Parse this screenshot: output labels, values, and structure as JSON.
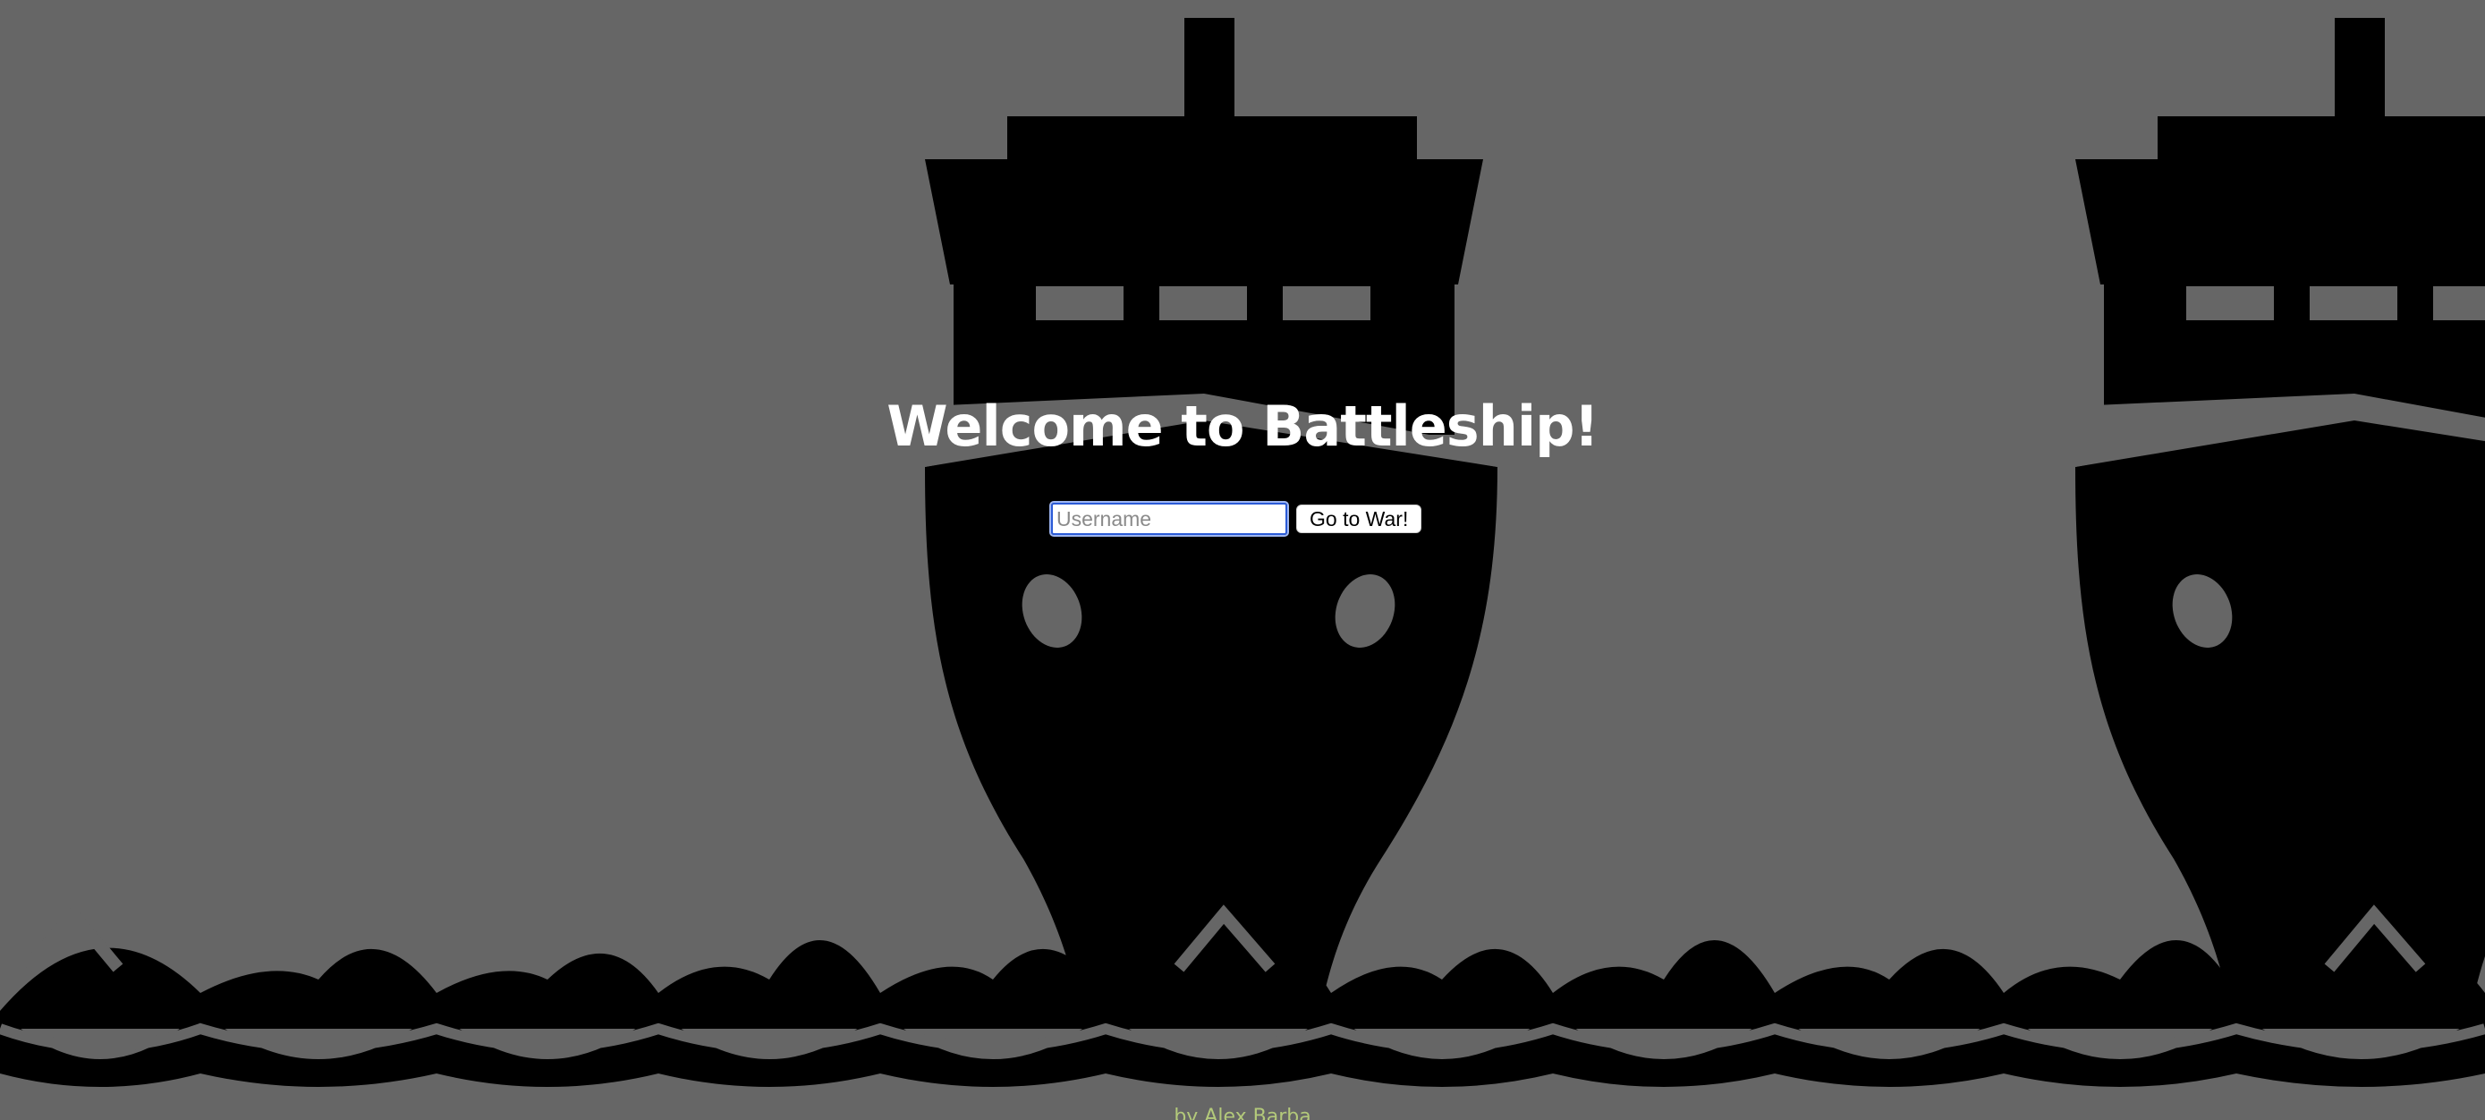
{
  "page": {
    "background_color": "#666666",
    "ship_color": "#000000"
  },
  "background": {
    "icon": "ship-icon",
    "repeat": 3
  },
  "welcome": {
    "title": "Welcome to Battleship!"
  },
  "form": {
    "username_placeholder": "Username",
    "username_value": "",
    "submit_label": "Go to War!"
  },
  "footer": {
    "credit": "by Alex Barba"
  }
}
